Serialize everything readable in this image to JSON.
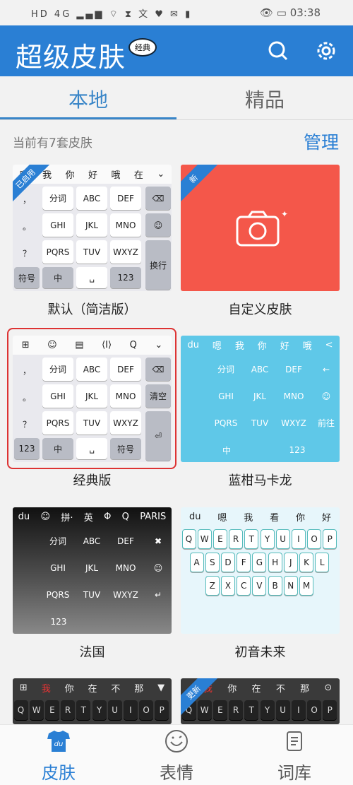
{
  "status_bar": {
    "left_icons": "HD 4G ▂▄▆ ⌔ ⧗ 文 ♥ ✉ ▮",
    "time": "03:38",
    "icons": [
      "eye-comfort-icon",
      "battery-icon"
    ]
  },
  "header": {
    "title": "超级皮肤",
    "badge": "经典",
    "icons": [
      "search-icon",
      "gear-icon"
    ]
  },
  "tabs": [
    {
      "label": "本地",
      "active": true
    },
    {
      "label": "精品",
      "active": false
    }
  ],
  "summary": {
    "count_text": "当前有7套皮肤",
    "manage": "管理"
  },
  "skins": [
    {
      "name": "默认（简洁版）",
      "ribbon": "已启用",
      "style": "default",
      "candidates": [
        "嗯",
        "我",
        "你",
        "好",
        "哦",
        "在",
        "⌄"
      ],
      "side": [
        "，",
        "。",
        "？",
        "！"
      ],
      "keys": [
        [
          "分词",
          "ABC",
          "DEF"
        ],
        [
          "GHI",
          "JKL",
          "MNO"
        ],
        [
          "PQRS",
          "TUV",
          "WXYZ"
        ]
      ],
      "right": [
        "⌫",
        "☺",
        "换行"
      ],
      "bottom": [
        "符号",
        "中",
        "␣",
        "123"
      ]
    },
    {
      "name": "自定义皮肤",
      "ribbon": "新",
      "style": "custom",
      "color": "#f4574a"
    },
    {
      "name": "经典版",
      "style": "classic",
      "selected": true,
      "candidates": [
        "⊞",
        "☺",
        "▤",
        "⟨I⟩",
        "Q",
        "⌄"
      ],
      "side": [
        "，",
        "。",
        "？",
        "！"
      ],
      "keys": [
        [
          "分词",
          "ABC",
          "DEF"
        ],
        [
          "GHI",
          "JKL",
          "MNO"
        ],
        [
          "PQRS",
          "TUV",
          "WXYZ"
        ]
      ],
      "right": [
        "⌫",
        "清空",
        "⏎"
      ],
      "bottom": [
        "123",
        "中",
        "␣",
        "符号"
      ]
    },
    {
      "name": "蓝柑马卡龙",
      "style": "blue",
      "color": "#5fc8e8",
      "candidates": [
        "du",
        "嗯",
        "我",
        "你",
        "好",
        "哦",
        "<"
      ],
      "keys": [
        [
          "分词",
          "ABC",
          "DEF"
        ],
        [
          "GHI",
          "JKL",
          "MNO"
        ],
        [
          "PQRS",
          "TUV",
          "WXYZ"
        ]
      ],
      "right": [
        "←",
        "☺",
        "前往"
      ],
      "bottom": [
        "中",
        "123"
      ]
    },
    {
      "name": "法国",
      "style": "paris",
      "candidates": [
        "du",
        "☺",
        "拼·",
        "英",
        "Φ",
        "Q",
        "PARIS"
      ],
      "keys": [
        [
          "分词",
          "ABC",
          "DEF"
        ],
        [
          "GHI",
          "JKL",
          "MNO"
        ],
        [
          "PQRS",
          "TUV",
          "WXYZ"
        ]
      ],
      "right": [
        "✖",
        "☺",
        "↵"
      ],
      "bottom": [
        "123"
      ]
    },
    {
      "name": "初音未来",
      "style": "miku",
      "candidates": [
        "du",
        "嗯",
        "我",
        "看",
        "你",
        "好"
      ],
      "rows": [
        "QWERTYUIOP",
        "ASDFGHJKL",
        "ZXCVBNM"
      ]
    },
    {
      "name": "",
      "style": "dark",
      "candidates": [
        "⊞",
        "我",
        "你",
        "在",
        "不",
        "那",
        "▼"
      ],
      "rows": [
        "QWERTYUIOP"
      ]
    },
    {
      "name": "",
      "ribbon": "更新",
      "style": "dark",
      "candidates": [
        "",
        "我",
        "你",
        "在",
        "不",
        "那",
        "⊙"
      ],
      "rows": [
        "QWERTYUIOP"
      ]
    }
  ],
  "bottom_nav": [
    {
      "label": "皮肤",
      "icon": "tshirt-icon",
      "active": true
    },
    {
      "label": "表情",
      "icon": "smiley-icon",
      "active": false
    },
    {
      "label": "词库",
      "icon": "dictionary-icon",
      "active": false
    }
  ],
  "colors": {
    "primary": "#2a7fd4",
    "selected_border": "#dd3333"
  }
}
